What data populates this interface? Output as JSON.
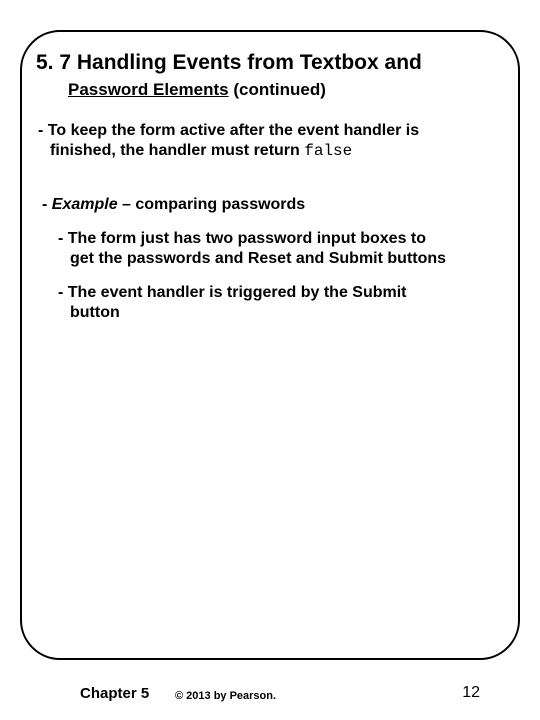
{
  "title": {
    "line1": "5. 7 Handling Events from Textbox and",
    "line2_underlined": "Password Elements",
    "line2_suffix": "(continued)"
  },
  "paragraphs": {
    "p1_a": "- To keep the form active after the event handler is",
    "p1_b": "finished, the handler must return ",
    "p1_code": "false",
    "p2_prefix": "- ",
    "p2_italic": "Example",
    "p2_rest": " – comparing passwords",
    "p3_a": "- The form just has two password input boxes to",
    "p3_b": "get the passwords and Reset and Submit buttons",
    "p4_a": "- The event handler is triggered by the Submit",
    "p4_b": "button"
  },
  "footer": {
    "chapter": "Chapter 5",
    "copyright": "© 2013 by Pearson.",
    "page": "12"
  }
}
